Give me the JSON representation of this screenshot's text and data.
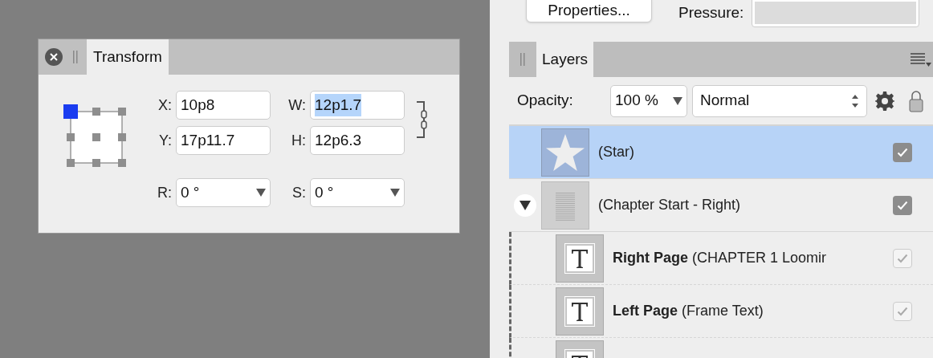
{
  "transform_panel": {
    "tabs": [
      {
        "label": "Transform",
        "selected": true
      }
    ],
    "anchor_points": [
      {
        "selected": true
      },
      {
        "selected": false
      },
      {
        "selected": false
      },
      {
        "selected": false
      },
      {
        "selected": false
      },
      {
        "selected": false
      },
      {
        "selected": false
      },
      {
        "selected": false
      },
      {
        "selected": false
      }
    ],
    "fields": [
      {
        "label": "X:",
        "value": "10p8",
        "text_selected": false
      },
      {
        "label": "W:",
        "value": "12p1.7",
        "text_selected": true
      },
      {
        "label": "Y:",
        "value": "17p11.7",
        "text_selected": false
      },
      {
        "label": "H:",
        "value": "12p6.3",
        "text_selected": false
      }
    ],
    "dropdowns": [
      {
        "label": "R:",
        "value": "0 °"
      },
      {
        "label": "S:",
        "value": "0 °"
      }
    ]
  },
  "brush_bar": {
    "button": "Properties...",
    "pressure_label": "Pressure:"
  },
  "layers_panel": {
    "tabs": [
      {
        "label": "Layers",
        "selected": true
      }
    ],
    "opacity_label": "Opacity:",
    "opacity": "100 %",
    "blend_mode": "Normal",
    "layers": [
      {
        "kind": "star",
        "name": "(Star)",
        "selected": true,
        "checked": true,
        "inherited": false
      },
      {
        "kind": "page",
        "name": "(Chapter Start - Right)",
        "selected": false,
        "checked": true,
        "inherited": false,
        "expanded": true,
        "children": [
          {
            "kind": "text",
            "name": "**Right Page** (CHAPTER 1 Loomir",
            "selected": false,
            "checked": true,
            "inherited": true
          },
          {
            "kind": "text",
            "name": "**Left Page** (Frame Text)",
            "selected": false,
            "checked": true,
            "inherited": true
          },
          {
            "kind": "text",
            "selected": false
          }
        ]
      }
    ]
  }
}
